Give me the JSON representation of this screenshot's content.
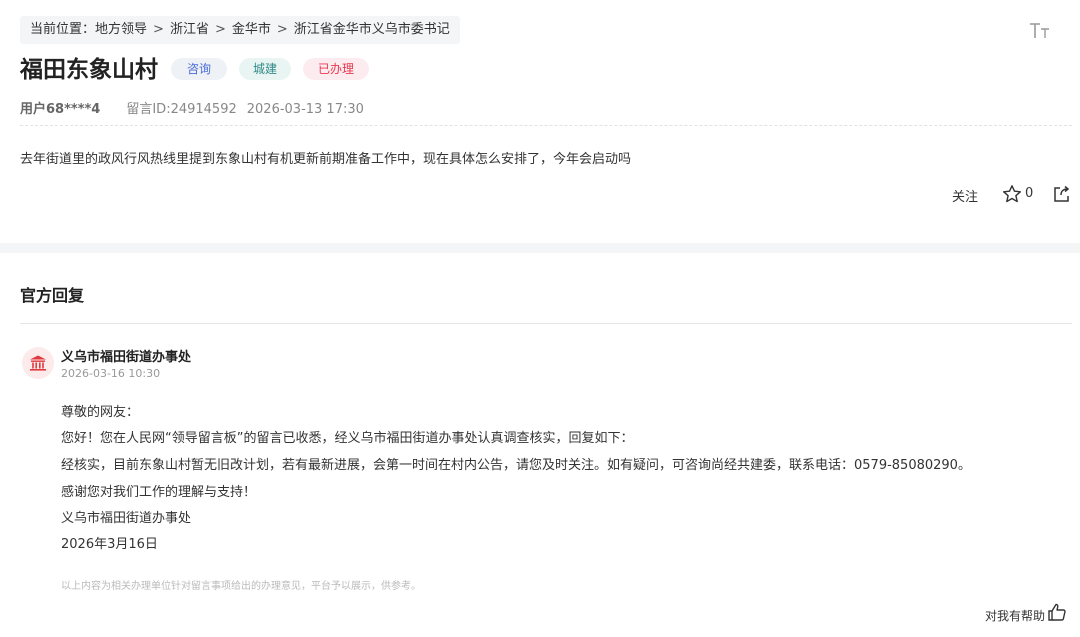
{
  "breadcrumb": {
    "prefix": "当前位置：",
    "items": [
      "地方领导",
      "浙江省",
      "金华市",
      "浙江省金华市义乌市委书记"
    ],
    "separator": ">"
  },
  "message": {
    "title": "福田东象山村",
    "tags": [
      "咨询",
      "城建",
      "已办理"
    ],
    "user": "用户68****4",
    "msg_id": "留言ID:24914592",
    "datetime": "2026-03-13 17:30",
    "content": "去年街道里的政风行风热线里提到东象山村有机更新前期准备工作中，现在具体怎么安排了，今年会启动吗"
  },
  "actions": {
    "follow_label": "关注",
    "star_count": "0"
  },
  "reply": {
    "heading": "官方回复",
    "org_name": "义乌市福田街道办事处",
    "date": "2026-03-16 10:30",
    "lines": [
      "尊敬的网友：",
      "您好！您在人民网“领导留言板”的留言已收悉，经义乌市福田街道办事处认真调查核实，回复如下：",
      "经核实，目前东象山村暂无旧改计划，若有最新进展，会第一时间在村内公告，请您及时关注。如有疑问，可咨询尚经共建委，联系电话：0579-85080290。",
      "感谢您对我们工作的理解与支持！",
      "义乌市福田街道办事处",
      "2026年3月16日"
    ],
    "disclaimer": "以上内容为相关办理单位针对留言事项给出的办理意见，平台予以展示，供参考。",
    "helpful_label": "对我有帮助"
  },
  "colors": {
    "tag_consult": "#4a6cd6",
    "tag_build": "#2f8a88",
    "tag_done": "#e8384f",
    "avatar_accent": "#e0393e"
  },
  "icons": [
    "font-size-icon",
    "star-icon",
    "share-icon",
    "government-building-icon",
    "thumbs-up-icon"
  ]
}
